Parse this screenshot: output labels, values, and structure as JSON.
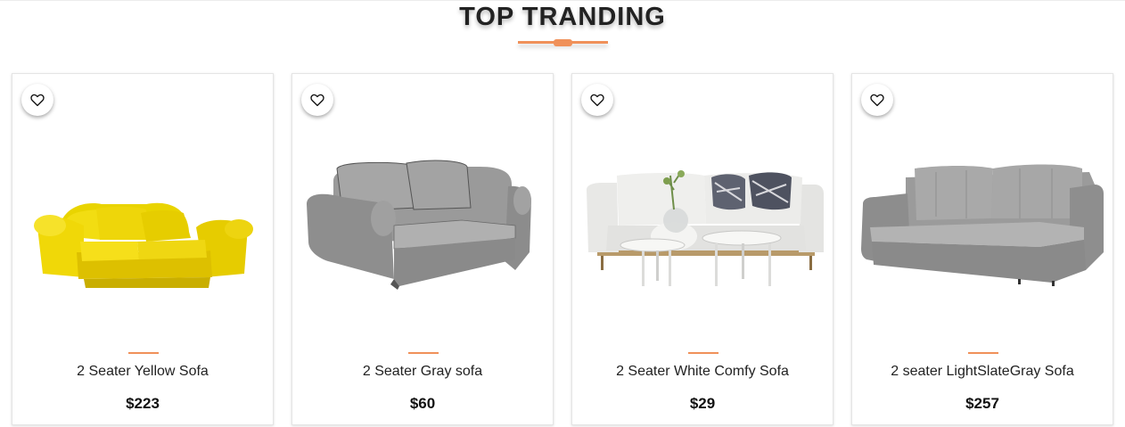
{
  "section": {
    "title": "TOP TRANDING",
    "accent_color": "#f0915a"
  },
  "products": [
    {
      "name": "2 Seater Yellow Sofa",
      "price": "$223",
      "image": "yellow-sofa-image",
      "wishlist_icon": "heart-outline-icon"
    },
    {
      "name": "2 Seater Gray sofa",
      "price": "$60",
      "image": "gray-sofa-image",
      "wishlist_icon": "heart-outline-icon"
    },
    {
      "name": "2 Seater White Comfy Sofa",
      "price": "$29",
      "image": "white-sofa-with-tables-image",
      "wishlist_icon": "heart-outline-icon"
    },
    {
      "name": "2 seater LightSlateGray Sofa",
      "price": "$257",
      "image": "lightslategray-sofa-image",
      "wishlist_icon": "heart-outline-icon"
    }
  ]
}
